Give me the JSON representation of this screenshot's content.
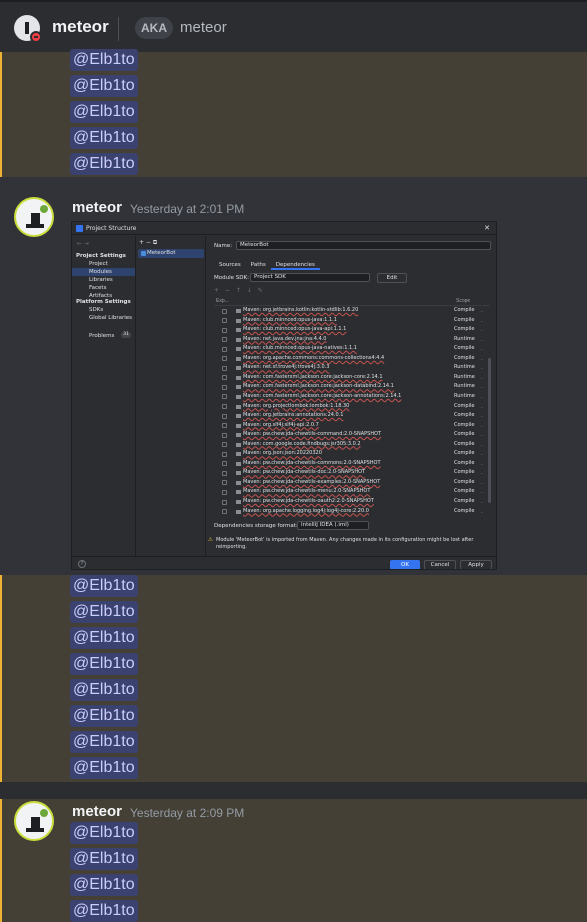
{
  "header": {
    "display_name": "meteor",
    "aka_label": "AKA",
    "aka_name": "meteor"
  },
  "mention_text": "@Elb1to",
  "messages": [
    {
      "author": "meteor",
      "timestamp": "Yesterday at 2:01 PM"
    },
    {
      "author": "meteor",
      "timestamp": "Yesterday at 2:09 PM"
    }
  ],
  "ide": {
    "window_title": "Project Structure",
    "nav": {
      "section_project": "Project Settings",
      "items_project": [
        "Project",
        "Modules",
        "Libraries",
        "Facets",
        "Artifacts"
      ],
      "section_platform": "Platform Settings",
      "items_platform": [
        "SDKs",
        "Global Libraries"
      ],
      "problems_label": "Problems",
      "problems_count": "31"
    },
    "module_name": "MeteorBot",
    "name_label": "Name:",
    "name_value": "MeteorBot",
    "tabs": [
      "Sources",
      "Paths",
      "Dependencies"
    ],
    "sdk_label": "Module SDK:",
    "sdk_value": "Project SDK",
    "edit_button": "Edit",
    "col_export": "Exp...",
    "col_scope": "Scope",
    "dependencies": [
      {
        "name": "Maven: org.jetbrains.kotlin:kotlin-stdlib:1.6.20",
        "scope": "Compile"
      },
      {
        "name": "Maven: club.minnced:opus-java:1.1.1",
        "scope": "Compile"
      },
      {
        "name": "Maven: club.minnced:opus-java-api:1.1.1",
        "scope": "Compile"
      },
      {
        "name": "Maven: net.java.dev.jna:jna:4.4.0",
        "scope": "Runtime"
      },
      {
        "name": "Maven: club.minnced:opus-java-natives:1.1.1",
        "scope": "Compile"
      },
      {
        "name": "Maven: org.apache.commons:commons-collections4:4.4",
        "scope": "Compile"
      },
      {
        "name": "Maven: net.sf.trove4j:trove4j:3.0.3",
        "scope": "Runtime"
      },
      {
        "name": "Maven: com.fasterxml.jackson.core:jackson-core:2.14.1",
        "scope": "Runtime"
      },
      {
        "name": "Maven: com.fasterxml.jackson.core:jackson-databind:2.14.1",
        "scope": "Runtime"
      },
      {
        "name": "Maven: com.fasterxml.jackson.core:jackson-annotations:2.14.1",
        "scope": "Runtime"
      },
      {
        "name": "Maven: org.projectlombok:lombok:1.18.30",
        "scope": "Compile"
      },
      {
        "name": "Maven: org.jetbrains:annotations:24.0.1",
        "scope": "Compile"
      },
      {
        "name": "Maven: org.slf4j:slf4j-api:2.0.7",
        "scope": "Compile"
      },
      {
        "name": "Maven: pw.chew:jda-chewtils-command:2.0-SNAPSHOT",
        "scope": "Compile"
      },
      {
        "name": "Maven: com.google.code.findbugs:jsr305:3.0.2",
        "scope": "Compile"
      },
      {
        "name": "Maven: org.json:json:20220320",
        "scope": "Compile"
      },
      {
        "name": "Maven: pw.chew:jda-chewtils-commons:2.0-SNAPSHOT",
        "scope": "Compile"
      },
      {
        "name": "Maven: pw.chew:jda-chewtils-doc:2.0-SNAPSHOT",
        "scope": "Compile"
      },
      {
        "name": "Maven: pw.chew:jda-chewtils-examples:2.0-SNAPSHOT",
        "scope": "Compile"
      },
      {
        "name": "Maven: pw.chew:jda-chewtils-menu:2.0-SNAPSHOT",
        "scope": "Compile"
      },
      {
        "name": "Maven: pw.chew:jda-chewtils-oauth2:2.0-SNAPSHOT",
        "scope": "Compile"
      },
      {
        "name": "Maven: org.apache.logging.log4j:log4j-core:2.20.0",
        "scope": "Compile"
      }
    ],
    "storage_label": "Dependencies storage format:",
    "storage_value": "IntelliJ IDEA (.iml)",
    "warning": "Module 'MeteorBot' is imported from Maven. Any changes made in its configuration might be lost after reimporting.",
    "buttons": {
      "ok": "OK",
      "cancel": "Cancel",
      "apply": "Apply"
    }
  }
}
